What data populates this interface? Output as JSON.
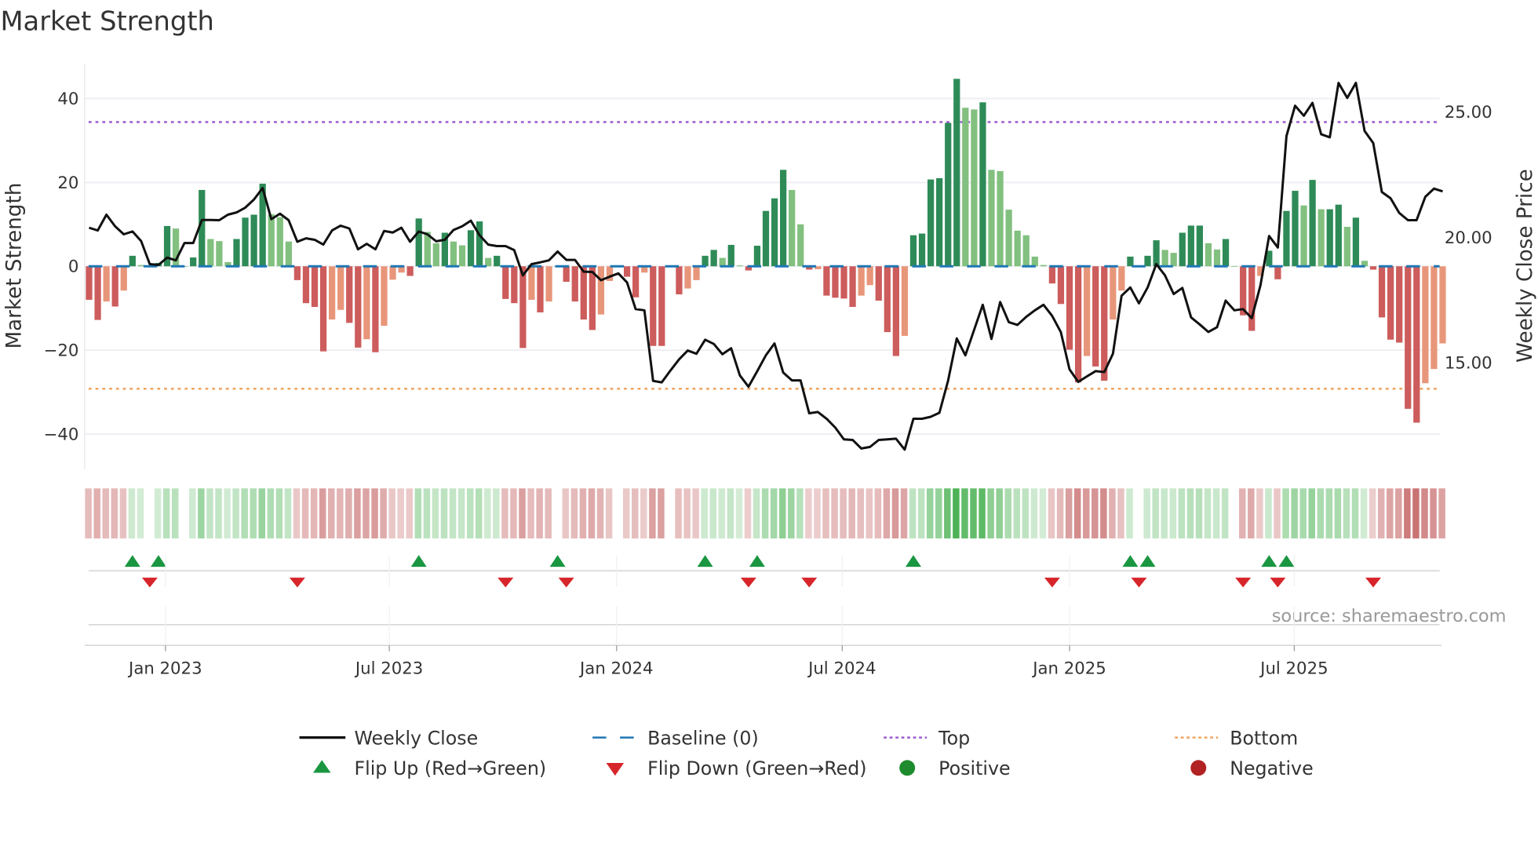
{
  "chart_data": {
    "type": "bar",
    "title": "Market Strength",
    "ylabel": "Market Strength",
    "y2label": "Weekly Close Price",
    "ylim": [
      -48.3,
      48.3
    ],
    "y2lim": [
      10.78,
      26.91
    ],
    "yticks": [
      40,
      20,
      0,
      -20,
      -40
    ],
    "ytick_labels": [
      "40",
      "20",
      "0",
      "−20",
      "−40"
    ],
    "y2ticks": [
      25,
      20,
      15
    ],
    "y2tick_labels": [
      "25.00",
      "20.00",
      "15.00"
    ],
    "top_level": 34.4,
    "bottom_level": -29.2,
    "baseline": 0,
    "xticks": [
      {
        "label": "Jan 2023",
        "week": 8.8
      },
      {
        "label": "Jul 2023",
        "week": 34.6
      },
      {
        "label": "Jan 2024",
        "week": 60.8
      },
      {
        "label": "Jul 2024",
        "week": 86.8
      },
      {
        "label": "Jan 2025",
        "week": 113.0
      },
      {
        "label": "Jul 2025",
        "week": 138.9
      }
    ],
    "strength": [
      -8,
      -12.8,
      -8.4,
      -9.6,
      -5.8,
      2.5,
      0.3,
      0,
      0.8,
      9.6,
      9,
      0,
      2.1,
      18.2,
      6.5,
      6,
      1,
      6.5,
      11.6,
      12.3,
      19.7,
      12.4,
      11.7,
      5.9,
      -3.3,
      -8.8,
      -9.7,
      -20.3,
      -12.7,
      -10.4,
      -13.5,
      -19.4,
      -17.4,
      -20.5,
      -14.2,
      -3.2,
      -1.5,
      -2.3,
      11.4,
      8.2,
      5.5,
      8,
      5.9,
      5,
      8.6,
      10.7,
      2,
      2.5,
      -7.8,
      -8.8,
      -19.5,
      -8,
      -11,
      -8.4,
      0,
      -3.7,
      -8.4,
      -12.7,
      -15.2,
      -11.5,
      -3.5,
      0,
      -2.5,
      -7.4,
      -1.5,
      -19,
      -19,
      0,
      -6.7,
      -5.3,
      -3.3,
      2.5,
      3.9,
      2,
      5.1,
      0.2,
      -1,
      4.9,
      13.2,
      16.2,
      23,
      18.2,
      10,
      -0.8,
      -0.7,
      -7,
      -7.5,
      -7.7,
      -9.7,
      -7,
      -4.5,
      -8.2,
      -15.7,
      -21.4,
      -16.6,
      7.4,
      7.8,
      20.7,
      21,
      34.2,
      44.7,
      37.8,
      37.4,
      39.1,
      23,
      22.7,
      13.5,
      8.5,
      7.4,
      2.3,
      0.3,
      -4.1,
      -9,
      -19.9,
      -27.7,
      -21.4,
      -23.9,
      -27.3,
      -12.7,
      -5.8,
      2.3,
      0,
      2.5,
      6.2,
      3.9,
      3.2,
      8,
      9.7,
      9.7,
      5.5,
      4,
      6.5,
      0,
      -11.7,
      -15.4,
      -2.3,
      3.7,
      -3.1,
      13.2,
      18,
      14.5,
      20.6,
      13.6,
      13.6,
      14.7,
      9.4,
      11.6,
      1.3,
      -0.8,
      -12.2,
      -17.5,
      -18.2,
      -34,
      -37.3,
      -27.9,
      -24.5,
      -18.4
    ],
    "weekly_close": [
      20.38,
      20.27,
      20.9,
      20.44,
      20.12,
      20.23,
      19.85,
      18.93,
      18.9,
      19.19,
      19.08,
      19.77,
      19.77,
      20.69,
      20.69,
      20.68,
      20.9,
      20.99,
      21.18,
      21.5,
      21.96,
      20.72,
      20.94,
      20.68,
      19.82,
      19.96,
      19.9,
      19.71,
      20.27,
      20.46,
      20.35,
      19.52,
      19.74,
      19.52,
      20.25,
      20.19,
      20.38,
      19.82,
      20.23,
      20.12,
      19.84,
      19.9,
      20.29,
      20.44,
      20.66,
      20.08,
      19.71,
      19.65,
      19.65,
      19.49,
      18.48,
      18.93,
      19.0,
      19.08,
      19.43,
      19.1,
      19.1,
      18.63,
      18.62,
      18.29,
      18.43,
      18.56,
      18.2,
      17.14,
      17.09,
      14.28,
      14.22,
      14.69,
      15.14,
      15.49,
      15.36,
      15.92,
      15.75,
      15.34,
      15.58,
      14.5,
      14.05,
      14.66,
      15.3,
      15.77,
      14.61,
      14.3,
      14.3,
      12.99,
      13.04,
      12.77,
      12.42,
      11.95,
      11.93,
      11.59,
      11.65,
      11.93,
      11.95,
      11.98,
      11.54,
      12.77,
      12.77,
      12.85,
      13.01,
      14.28,
      15.97,
      15.3,
      16.31,
      17.31,
      15.95,
      17.42,
      16.62,
      16.51,
      16.83,
      17.09,
      17.31,
      16.87,
      16.22,
      14.74,
      14.24,
      14.46,
      14.67,
      14.63,
      15.36,
      17.67,
      18.0,
      17.37,
      18.0,
      18.93,
      18.48,
      17.74,
      17.98,
      16.81,
      16.53,
      16.23,
      16.42,
      17.48,
      17.09,
      17.14,
      16.78,
      18.09,
      20.05,
      19.59,
      24.03,
      25.24,
      24.84,
      25.35,
      24.1,
      23.98,
      26.15,
      25.55,
      26.15,
      24.23,
      23.75,
      21.8,
      21.55,
      20.97,
      20.68,
      20.68,
      21.61,
      21.94,
      21.83
    ],
    "flip_up_weeks": [
      5,
      8,
      38,
      54,
      71,
      77,
      95,
      120,
      122,
      136,
      138
    ],
    "flip_down_weeks": [
      7,
      24,
      48,
      55,
      76,
      83,
      111,
      121,
      133,
      137,
      148
    ],
    "legend": {
      "placement": "bottom",
      "items": [
        {
          "label": "Weekly Close",
          "kind": "line"
        },
        {
          "label": "Baseline (0)",
          "kind": "dash"
        },
        {
          "label": "Top",
          "kind": "dot-purple"
        },
        {
          "label": "Bottom",
          "kind": "dot-orange"
        },
        {
          "label": "Flip Up (Red→Green)",
          "kind": "tri-up"
        },
        {
          "label": "Flip Down (Green→Red)",
          "kind": "tri-down"
        },
        {
          "label": "Positive",
          "kind": "circle-green"
        },
        {
          "label": "Negative",
          "kind": "circle-red"
        }
      ]
    },
    "source": "source: sharemaestro.com"
  },
  "colors": {
    "pos_dark": "#2e8b57",
    "pos_light": "#82c07f",
    "neg_dark": "#cd5c5c",
    "neg_light": "#e8967a",
    "line": "#111111",
    "baseline": "#1f77b4",
    "top": "#9b59d0",
    "bottom": "#f0a35e",
    "flip_up": "#1a9641",
    "flip_down": "#d7262b",
    "positive": "#1e8c2e",
    "negative": "#b22222"
  }
}
